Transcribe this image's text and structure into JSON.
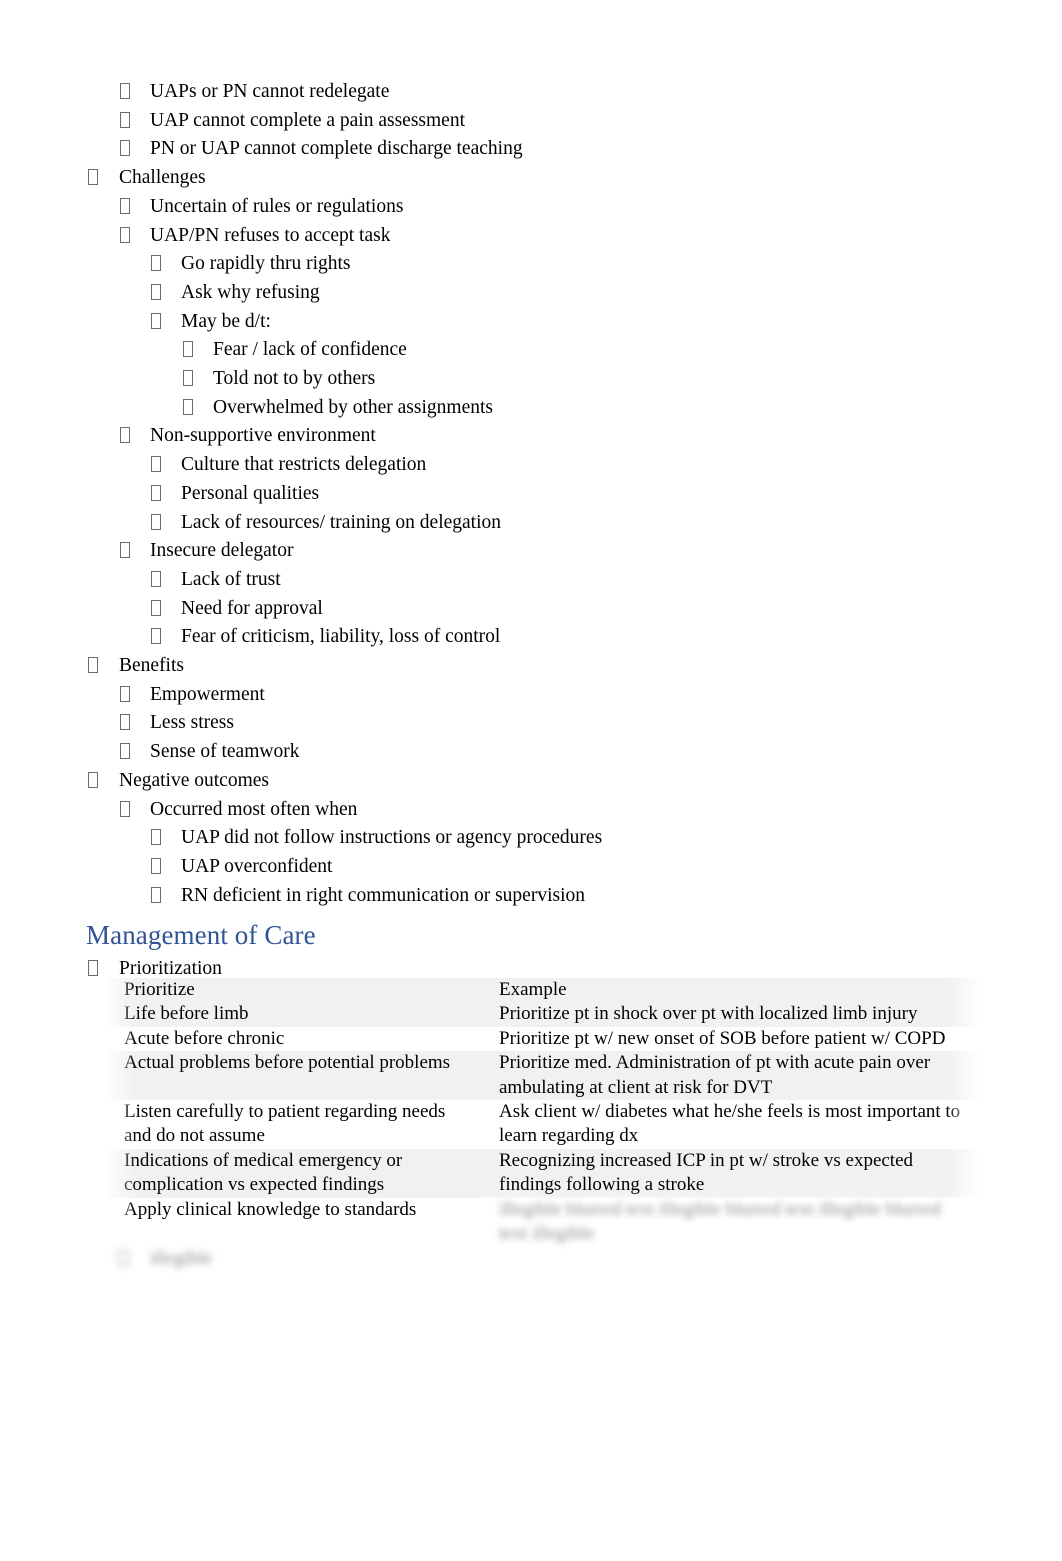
{
  "document": {
    "heading_color": "#2f5496",
    "bullet_glyph": "missing-glyph-box"
  },
  "outline": [
    {
      "level": 2,
      "text": "UAPs or PN cannot redelegate"
    },
    {
      "level": 2,
      "text": "UAP cannot complete a pain assessment"
    },
    {
      "level": 2,
      "text": "PN or UAP cannot complete discharge teaching"
    },
    {
      "level": 1,
      "text": "Challenges"
    },
    {
      "level": 2,
      "text": "Uncertain of rules or regulations"
    },
    {
      "level": 2,
      "text": "UAP/PN refuses to accept task"
    },
    {
      "level": 3,
      "text": "Go rapidly thru rights"
    },
    {
      "level": 3,
      "text": "Ask why refusing"
    },
    {
      "level": 3,
      "text": "May be d/t:"
    },
    {
      "level": 4,
      "text": "Fear / lack of confidence"
    },
    {
      "level": 4,
      "text": "Told not to by others"
    },
    {
      "level": 4,
      "text": "Overwhelmed by other assignments"
    },
    {
      "level": 2,
      "text": "Non-supportive environment"
    },
    {
      "level": 3,
      "text": "Culture that restricts delegation"
    },
    {
      "level": 3,
      "text": "Personal qualities"
    },
    {
      "level": 3,
      "text": "Lack of resources/ training on delegation"
    },
    {
      "level": 2,
      "text": "Insecure delegator"
    },
    {
      "level": 3,
      "text": "Lack of trust"
    },
    {
      "level": 3,
      "text": "Need for approval"
    },
    {
      "level": 3,
      "text": "Fear of criticism, liability, loss of control"
    },
    {
      "level": 1,
      "text": "Benefits"
    },
    {
      "level": 2,
      "text": "Empowerment"
    },
    {
      "level": 2,
      "text": "Less stress"
    },
    {
      "level": 2,
      "text": "Sense of teamwork"
    },
    {
      "level": 1,
      "text": "Negative outcomes"
    },
    {
      "level": 2,
      "text": "Occurred most often when"
    },
    {
      "level": 3,
      "text": "UAP did not follow instructions or agency procedures"
    },
    {
      "level": 3,
      "text": "UAP overconfident"
    },
    {
      "level": 3,
      "text": "RN deficient in right communication or supervision"
    }
  ],
  "section": {
    "heading": "Management of Care",
    "first_bullet": "Prioritization"
  },
  "table": {
    "headers": [
      "Prioritize",
      "Example"
    ],
    "rows": [
      {
        "prioritize": "Life before limb",
        "example": "Prioritize pt in shock over pt with localized limb injury",
        "illegible": false
      },
      {
        "prioritize": "Acute before chronic",
        "example": "Prioritize pt w/ new onset of SOB before patient w/ COPD",
        "illegible": false
      },
      {
        "prioritize": "Actual problems before potential problems",
        "example": "Prioritize med. Administration of pt with acute pain over ambulating at client at risk for DVT",
        "illegible": false
      },
      {
        "prioritize": "Listen carefully to patient regarding needs and do not assume",
        "example": "Ask client w/ diabetes what he/she feels is most important to learn regarding dx",
        "illegible": false
      },
      {
        "prioritize": "Indications of medical emergency or complication vs expected findings",
        "example": "Recognizing increased ICP in pt w/ stroke vs expected findings following a stroke",
        "illegible": false
      },
      {
        "prioritize": "Apply clinical knowledge to standards",
        "example": "illegible blurred text illegible blurred text illegible blurred text illegible",
        "illegible": true
      }
    ]
  },
  "tail_fragment": {
    "text": "illegible",
    "illegible": true
  }
}
